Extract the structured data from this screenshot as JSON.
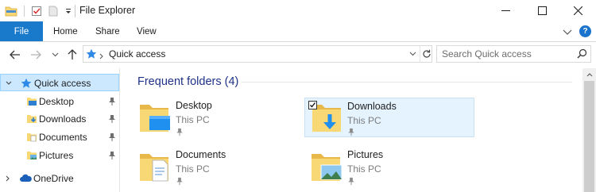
{
  "window": {
    "title": "File Explorer"
  },
  "ribbon": {
    "tabs": [
      {
        "label": "File"
      },
      {
        "label": "Home"
      },
      {
        "label": "Share"
      },
      {
        "label": "View"
      }
    ],
    "help_label": "?"
  },
  "address": {
    "location": "Quick access"
  },
  "search": {
    "placeholder": "Search Quick access"
  },
  "nav": {
    "items": [
      {
        "label": "Quick access",
        "icon": "star-icon"
      },
      {
        "label": "Desktop",
        "icon": "desktop-folder-icon"
      },
      {
        "label": "Downloads",
        "icon": "downloads-folder-icon"
      },
      {
        "label": "Documents",
        "icon": "documents-folder-icon"
      },
      {
        "label": "Pictures",
        "icon": "pictures-folder-icon"
      },
      {
        "label": "OneDrive",
        "icon": "cloud-icon"
      }
    ]
  },
  "content": {
    "section_title": "Frequent folders (4)",
    "folders": [
      {
        "name": "Desktop",
        "location": "This PC",
        "icon": "desktop-folder-icon",
        "selected": false
      },
      {
        "name": "Downloads",
        "location": "This PC",
        "icon": "downloads-folder-icon",
        "selected": true
      },
      {
        "name": "Documents",
        "location": "This PC",
        "icon": "documents-folder-icon",
        "selected": false
      },
      {
        "name": "Pictures",
        "location": "This PC",
        "icon": "pictures-folder-icon",
        "selected": false
      }
    ]
  },
  "colors": {
    "accent": "#1979ca",
    "selection": "#cce8ff",
    "folder": "#f8d775",
    "section_title": "#1e3287"
  }
}
